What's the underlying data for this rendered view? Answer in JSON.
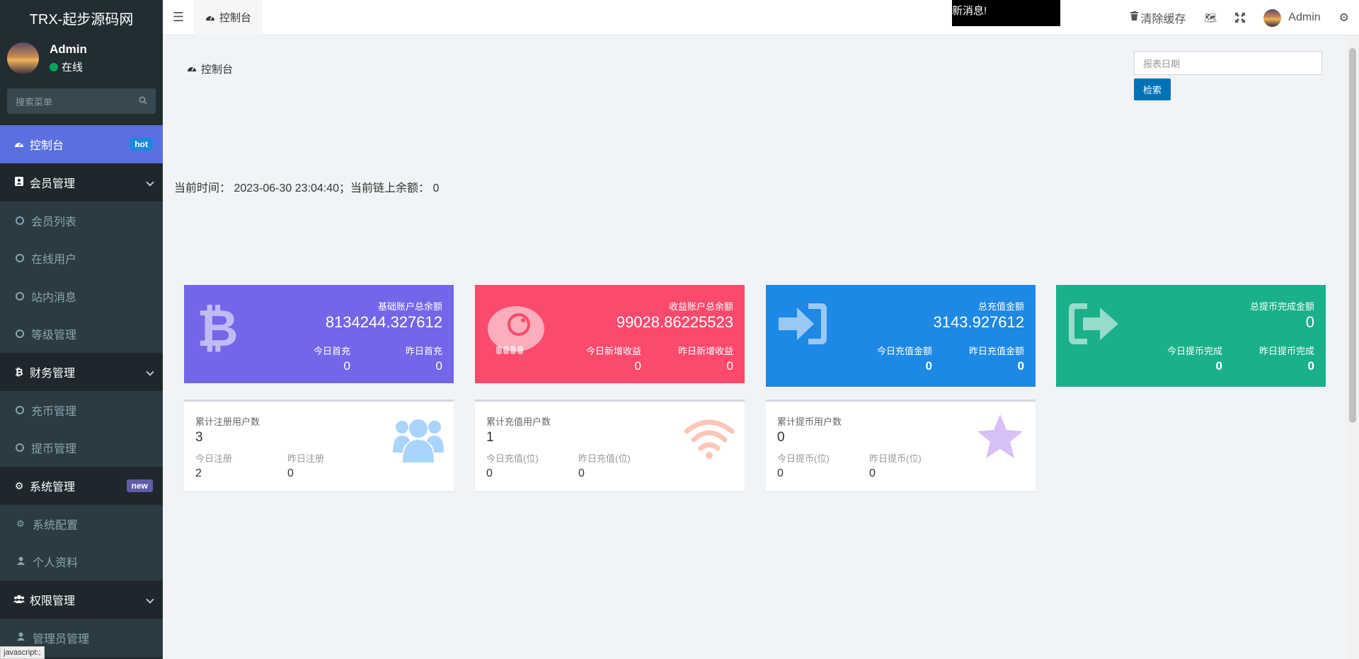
{
  "sidebar": {
    "logo": "TRX-起步源码网",
    "user": {
      "name": "Admin",
      "status": "在线"
    },
    "search_placeholder": "搜索菜单",
    "menu": {
      "dashboard": {
        "label": "控制台",
        "badge": "hot"
      },
      "members": {
        "label": "会员管理",
        "items": [
          "会员列表",
          "在线用户",
          "站内消息",
          "等级管理"
        ]
      },
      "finance": {
        "label": "财务管理",
        "items": [
          "充币管理",
          "提币管理"
        ]
      },
      "system": {
        "label": "系统管理",
        "badge": "new",
        "items": [
          "系统配置",
          "个人资料"
        ]
      },
      "auth": {
        "label": "权限管理",
        "items": [
          "管理员管理"
        ]
      }
    },
    "status_tip": "javascript:;"
  },
  "header": {
    "tab": "控制台",
    "marquee": "新消息!",
    "clear_cache": "清除缓存",
    "user": "Admin"
  },
  "content": {
    "breadcrumb": "控制台",
    "date_placeholder": "报表日期",
    "search_button": "检索",
    "time_line": "当前时间：  2023-06-30 23:04:40；当前链上余额：  0"
  },
  "cards": [
    {
      "title": "基础账户总余额",
      "value": "8134244.327612",
      "l1_label": "今日首充",
      "l1_value": "0",
      "l2_label": "昨日首充",
      "l2_value": "0",
      "color": "#7466e8",
      "icon": "bitcoin-icon"
    },
    {
      "title": "收益账户总余额",
      "value": "99028.86225523",
      "l1_label": "今日新增收益",
      "l1_value": "0",
      "l2_label": "昨日新增收益",
      "l2_value": "0",
      "color": "#fb4a6b",
      "icon": "elephant-icon"
    },
    {
      "title": "总充值金额",
      "value": "3143.927612",
      "l1_label": "今日充值金额",
      "l1_value": "0",
      "l2_label": "昨日充值金额",
      "l2_value": "0",
      "color": "#1e88e5",
      "icon": "sign-in-icon"
    },
    {
      "title": "总提币完成金额",
      "value": "0",
      "l1_label": "今日提币完成",
      "l1_value": "0",
      "l2_label": "昨日提币完成",
      "l2_value": "0",
      "color": "#19b08a",
      "icon": "sign-out-icon"
    }
  ],
  "stats": [
    {
      "title": "累计注册用户数",
      "value": "3",
      "l1_label": "今日注册",
      "l1_value": "2",
      "l2_label": "昨日注册",
      "l2_value": "0",
      "icon": "users-icon",
      "icon_color": "#a9d4fb"
    },
    {
      "title": "累计充值用户数",
      "value": "1",
      "l1_label": "今日充值(位)",
      "l1_value": "0",
      "l2_label": "昨日充值(位)",
      "l2_value": "0",
      "icon": "wifi-icon",
      "icon_color": "#fbc5b7"
    },
    {
      "title": "累计提币用户数",
      "value": "0",
      "l1_label": "今日提币(位)",
      "l1_value": "0",
      "l2_label": "昨日提币(位)",
      "l2_value": "0",
      "icon": "star-icon",
      "icon_color": "#d7bff8"
    }
  ]
}
